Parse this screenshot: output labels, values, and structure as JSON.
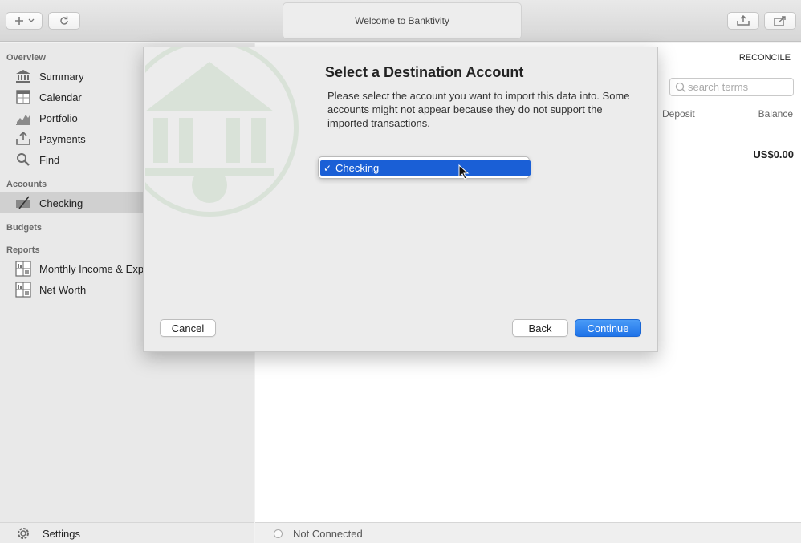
{
  "toolbar": {
    "add_icon": "plus-icon",
    "refresh_icon": "refresh-icon",
    "title": "Welcome to Banktivity",
    "import_icon": "import-icon",
    "share_icon": "share-icon"
  },
  "sidebar": {
    "overview_label": "Overview",
    "overview_items": [
      {
        "label": "Summary",
        "icon": "bank-icon"
      },
      {
        "label": "Calendar",
        "icon": "calendar-icon"
      },
      {
        "label": "Portfolio",
        "icon": "portfolio-icon"
      },
      {
        "label": "Payments",
        "icon": "payments-icon"
      },
      {
        "label": "Find",
        "icon": "magnifier-icon"
      }
    ],
    "accounts_label": "Accounts",
    "account_items": [
      {
        "label": "Checking",
        "icon": "checking-icon",
        "selected": true
      }
    ],
    "budgets_label": "Budgets",
    "reports_label": "Reports",
    "report_items": [
      {
        "label": "Monthly Income & Expenses",
        "icon": "report-icon"
      },
      {
        "label": "Net Worth",
        "icon": "report-icon"
      }
    ],
    "settings_label": "Settings"
  },
  "main": {
    "reconcile_label": "RECONCILE",
    "search_placeholder": "search terms",
    "columns": [
      "Deposit",
      "Balance"
    ],
    "balance_value": "US$0.00",
    "status_text": "Not Connected"
  },
  "dialog": {
    "title": "Select a Destination Account",
    "description": "Please select the account you want to import this data into. Some accounts might not appear because they do not support the imported transactions.",
    "selected_account": "Checking",
    "check_mark": "✓",
    "cancel_label": "Cancel",
    "back_label": "Back",
    "continue_label": "Continue"
  },
  "colors": {
    "accent": "#1a5fd6",
    "primary_button": "#1f73e8",
    "sidebar_bg": "#e9e9e9",
    "sidebar_selected": "#d0d0d0",
    "watermark": "#7fb57a"
  }
}
